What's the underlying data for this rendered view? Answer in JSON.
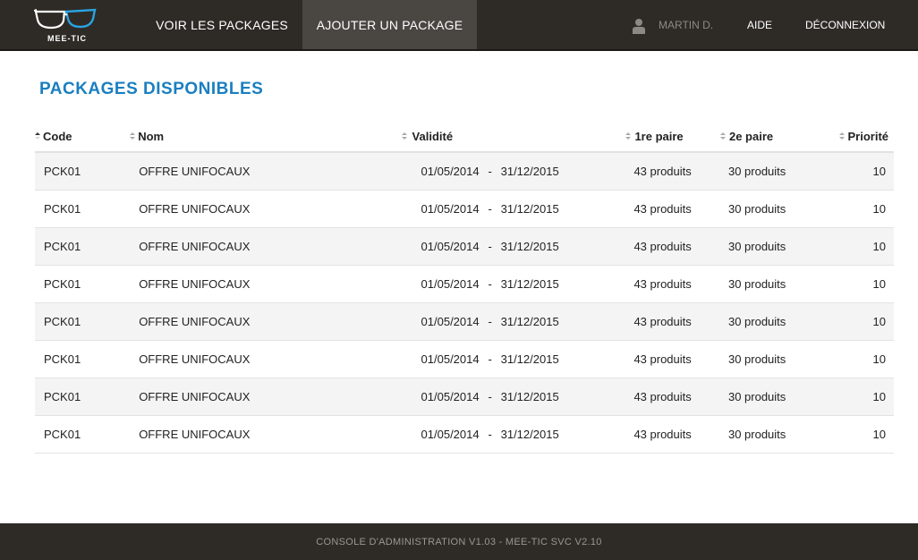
{
  "header": {
    "logo_text": "MEE-TIC",
    "nav": [
      {
        "label": "VOIR LES PACKAGES",
        "active": false
      },
      {
        "label": "AJOUTER UN PACKAGE",
        "active": true
      }
    ],
    "user_name": "MARTIN D.",
    "help_label": "AIDE",
    "logout_label": "DÉCONNEXION",
    "colors": {
      "bar": "#2e2b27",
      "active_tab": "#4a4642",
      "logo_accent": "#2aa3e0"
    }
  },
  "main": {
    "title": "PACKAGES DISPONIBLES",
    "title_color": "#1a7fc0",
    "table": {
      "columns": [
        "Code",
        "Nom",
        "Validité",
        "1re paire",
        "2e paire",
        "Priorité"
      ],
      "sorted_column": "Code",
      "rows": [
        {
          "code": "PCK01",
          "nom": "OFFRE UNIFOCAUX",
          "from": "01/05/2014",
          "sep": "-",
          "to": "31/12/2015",
          "p1": "43 produits",
          "p2": "30 produits",
          "prio": "10"
        },
        {
          "code": "PCK01",
          "nom": "OFFRE UNIFOCAUX",
          "from": "01/05/2014",
          "sep": "-",
          "to": "31/12/2015",
          "p1": "43 produits",
          "p2": "30 produits",
          "prio": "10"
        },
        {
          "code": "PCK01",
          "nom": "OFFRE UNIFOCAUX",
          "from": "01/05/2014",
          "sep": "-",
          "to": "31/12/2015",
          "p1": "43 produits",
          "p2": "30 produits",
          "prio": "10"
        },
        {
          "code": "PCK01",
          "nom": "OFFRE UNIFOCAUX",
          "from": "01/05/2014",
          "sep": "-",
          "to": "31/12/2015",
          "p1": "43 produits",
          "p2": "30 produits",
          "prio": "10"
        },
        {
          "code": "PCK01",
          "nom": "OFFRE UNIFOCAUX",
          "from": "01/05/2014",
          "sep": "-",
          "to": "31/12/2015",
          "p1": "43 produits",
          "p2": "30 produits",
          "prio": "10"
        },
        {
          "code": "PCK01",
          "nom": "OFFRE UNIFOCAUX",
          "from": "01/05/2014",
          "sep": "-",
          "to": "31/12/2015",
          "p1": "43 produits",
          "p2": "30 produits",
          "prio": "10"
        },
        {
          "code": "PCK01",
          "nom": "OFFRE UNIFOCAUX",
          "from": "01/05/2014",
          "sep": "-",
          "to": "31/12/2015",
          "p1": "43 produits",
          "p2": "30 produits",
          "prio": "10"
        },
        {
          "code": "PCK01",
          "nom": "OFFRE UNIFOCAUX",
          "from": "01/05/2014",
          "sep": "-",
          "to": "31/12/2015",
          "p1": "43 produits",
          "p2": "30 produits",
          "prio": "10"
        }
      ]
    }
  },
  "footer": {
    "text": "CONSOLE D'ADMINISTRATION V1.03 - MEE-TIC SVC V2.10"
  },
  "icons": [
    "glasses-logo-icon",
    "user-icon",
    "sort-icon"
  ]
}
